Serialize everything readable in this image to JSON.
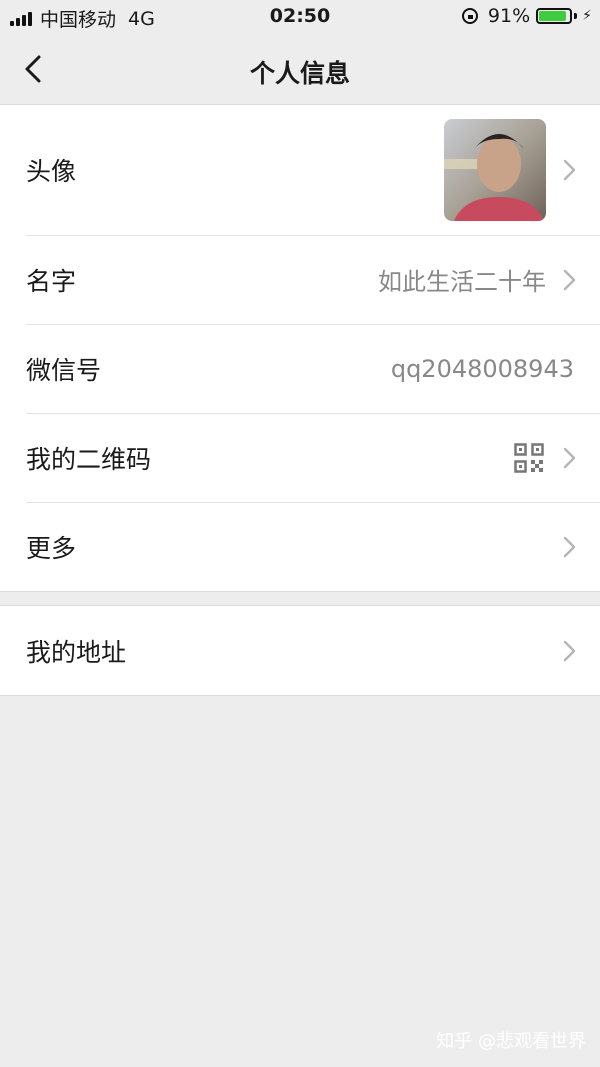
{
  "status": {
    "carrier": "中国移动",
    "network": "4G",
    "time": "02:50",
    "battery_text": "91%",
    "battery_level": 0.91,
    "battery_color": "#3fcd3f"
  },
  "nav": {
    "title": "个人信息",
    "back_icon": "chevron-left-icon"
  },
  "profile": {
    "avatar_label": "头像",
    "name_label": "名字",
    "name_value": "如此生活二十年",
    "wechat_id_label": "微信号",
    "wechat_id_value": "qq2048008943",
    "qr_label": "我的二维码",
    "more_label": "更多"
  },
  "address": {
    "label": "我的地址"
  },
  "watermark": "知乎 @悲观看世界"
}
